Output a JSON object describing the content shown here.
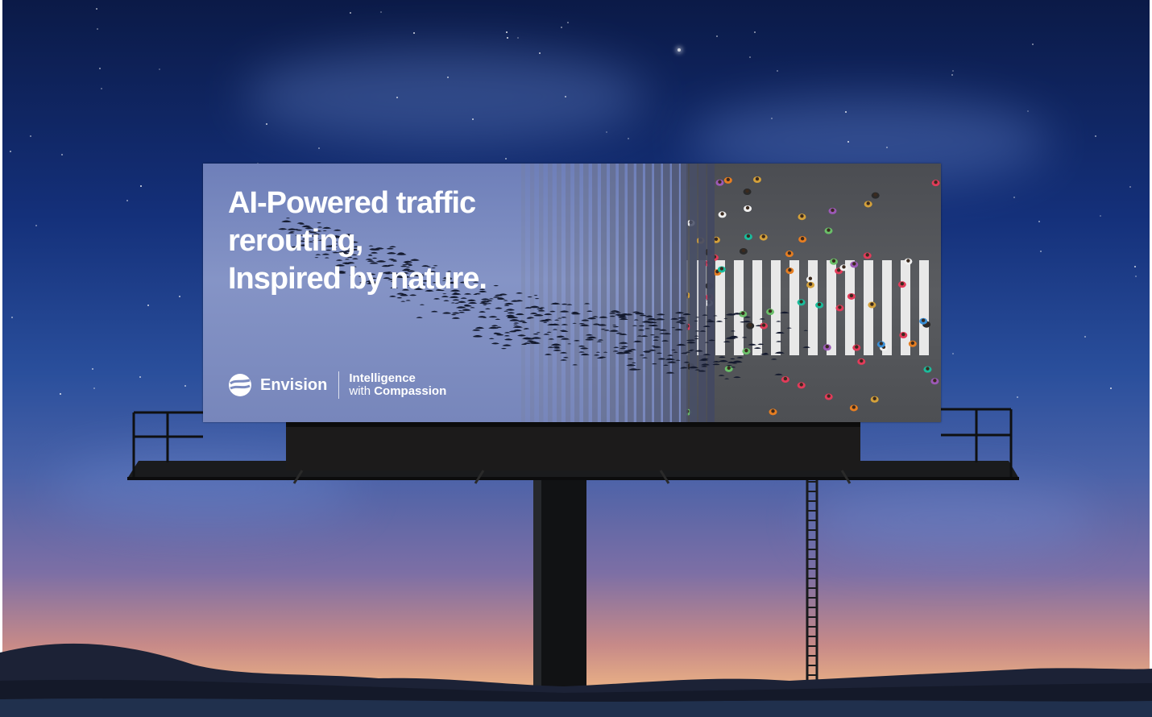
{
  "billboard": {
    "headline_line1": "AI-Powered traffic",
    "headline_line2": "rerouting,",
    "headline_line3": "Inspired by nature.",
    "brand_name": "Envision",
    "tagline_line1": "Intelligence",
    "tagline_with": "with",
    "tagline_bold": "Compassion"
  },
  "icons": {
    "logo": "envision-logo-icon"
  },
  "colors": {
    "sky_top": "#0b1a47",
    "sky_horizon": "#e9b085",
    "billboard_bg": "#8594c6",
    "street": "#55575b",
    "text": "#ffffff"
  }
}
